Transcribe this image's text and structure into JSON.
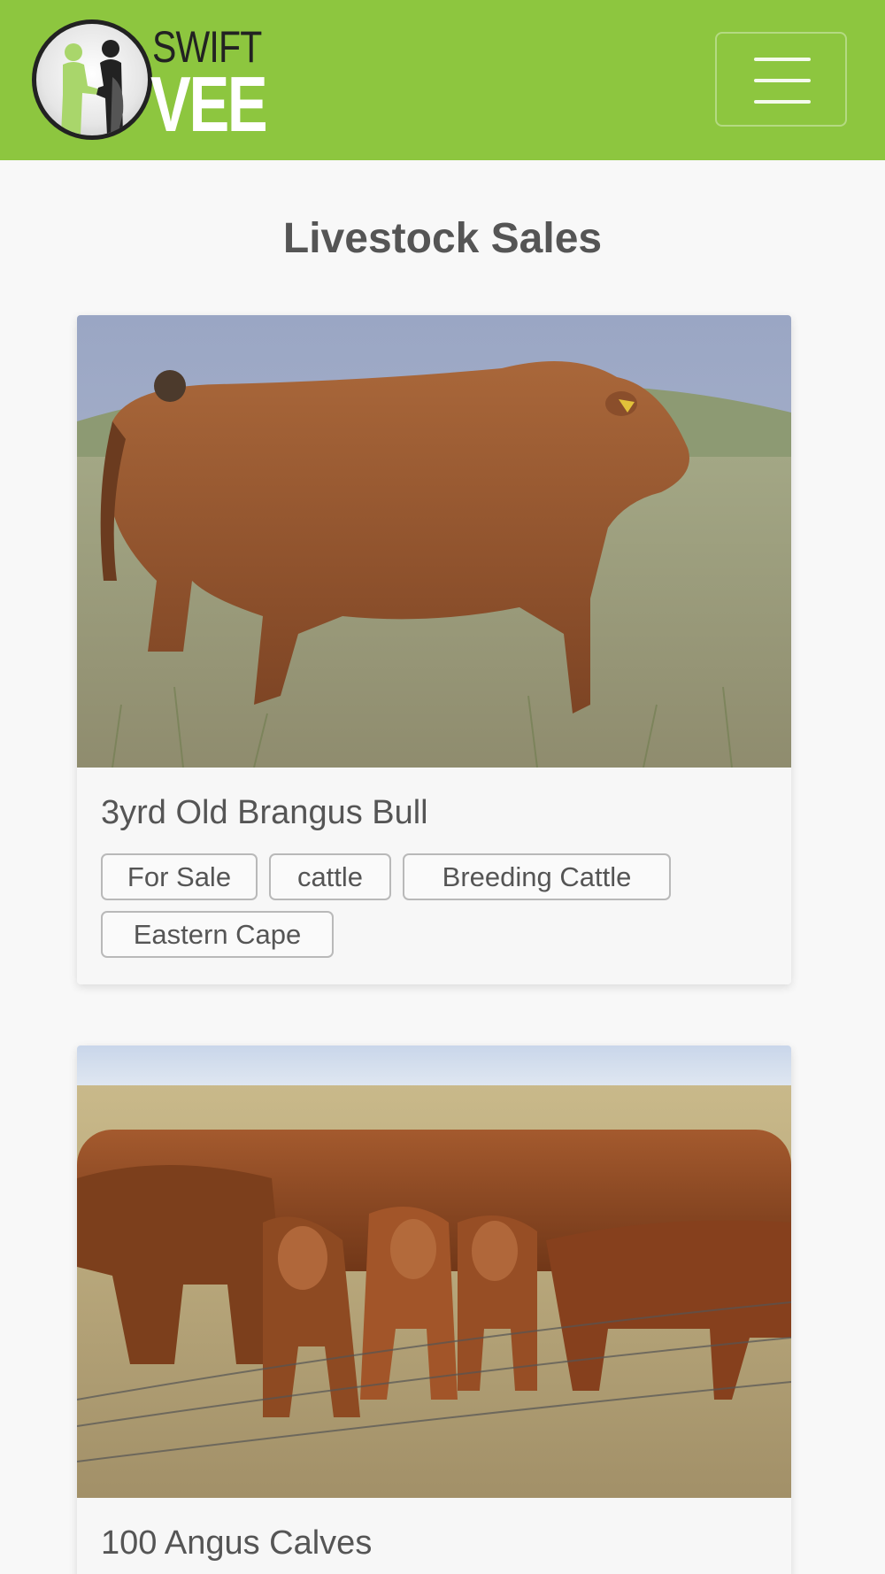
{
  "brand": {
    "line1": "SWIFT",
    "line2": "VEE",
    "color": "#8dc63f"
  },
  "nav": {
    "menu_icon": "hamburger-menu-icon"
  },
  "page": {
    "title": "Livestock Sales"
  },
  "listings": [
    {
      "title": "3yrd Old Brangus Bull",
      "tags": [
        "For Sale",
        "cattle",
        "Breeding Cattle",
        "Eastern Cape"
      ]
    },
    {
      "title": "100 Angus Calves",
      "tags": []
    }
  ]
}
